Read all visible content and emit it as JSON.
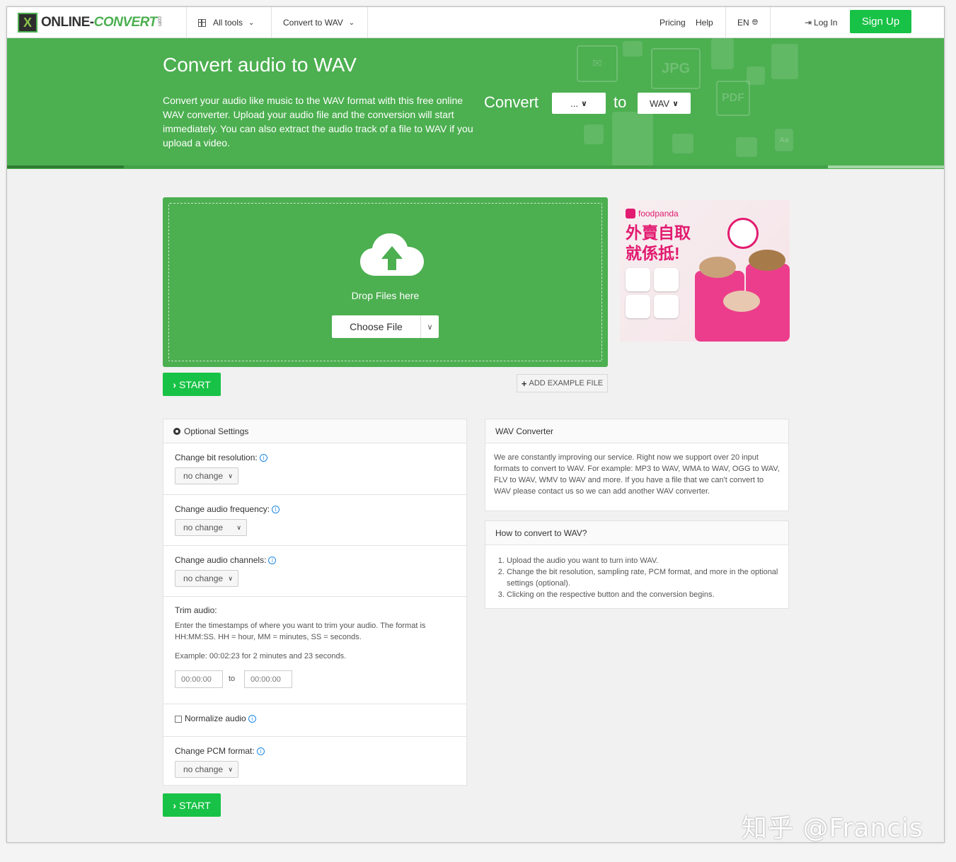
{
  "header": {
    "logo_text_a": "ONLINE-",
    "logo_text_b": "CONVERT",
    "logo_suffix": "com",
    "all_tools": "All tools",
    "convert_to": "Convert to WAV",
    "pricing": "Pricing",
    "help": "Help",
    "language": "EN",
    "login": "Log In",
    "signup": "Sign Up"
  },
  "hero": {
    "title": "Convert audio to WAV",
    "description": "Convert your audio like music to the WAV format with this free online WAV converter. Upload your audio file and the conversion will start immediately. You can also extract the audio track of a file to WAV if you upload a video.",
    "convert_label": "Convert",
    "from_value": "...",
    "to_label": "to",
    "to_value": "WAV",
    "deco_labels": [
      "JPG",
      "PDF",
      "Aa"
    ]
  },
  "upload": {
    "drop_text": "Drop Files here",
    "choose_file": "Choose File",
    "start": "START",
    "add_example": "ADD EXAMPLE FILE"
  },
  "ad": {
    "brand": "foodpanda",
    "headline_1": "外賣自取",
    "headline_2": "就係抵!"
  },
  "settings": {
    "title": "Optional Settings",
    "bit_resolution_label": "Change bit resolution:",
    "bit_resolution_value": "no change",
    "frequency_label": "Change audio frequency:",
    "frequency_value": "no change",
    "channels_label": "Change audio channels:",
    "channels_value": "no change",
    "trim_label": "Trim audio:",
    "trim_desc": "Enter the timestamps of where you want to trim your audio. The format is HH:MM:SS. HH = hour, MM = minutes, SS = seconds.",
    "trim_example": "Example: 00:02:23 for 2 minutes and 23 seconds.",
    "trim_from_placeholder": "00:00:00",
    "trim_to_label": "to",
    "trim_to_placeholder": "00:00:00",
    "normalize_label": "Normalize audio",
    "pcm_label": "Change PCM format:",
    "pcm_value": "no change",
    "start": "START"
  },
  "info_panels": {
    "wav_title": "WAV Converter",
    "wav_text": "We are constantly improving our service. Right now we support over 20 input formats to convert to WAV. For example: MP3 to WAV, WMA to WAV, OGG to WAV, FLV to WAV, WMV to WAV and more. If you have a file that we can't convert to WAV please contact us so we can add another WAV converter.",
    "howto_title": "How to convert to WAV?",
    "howto_steps": [
      "Upload the audio you want to turn into WAV.",
      "Change the bit resolution, sampling rate, PCM format, and more in the optional settings (optional).",
      "Clicking on the respective button and the conversion begins."
    ]
  },
  "watermark": "知乎 @Francis",
  "colors": {
    "brand_green": "#4caf50",
    "button_green": "#18c246",
    "ad_pink": "#e21b70"
  }
}
